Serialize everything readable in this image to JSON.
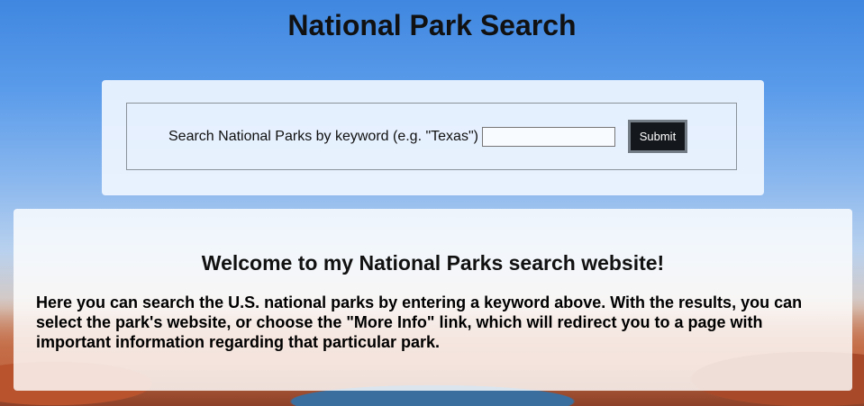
{
  "header": {
    "title": "National Park Search"
  },
  "search": {
    "label": "Search National Parks by keyword (e.g. \"Texas\")",
    "input_value": "",
    "submit_label": "Submit"
  },
  "welcome": {
    "heading": "Welcome to my National Parks search website!",
    "body": "Here you can search the U.S. national parks by entering a keyword above. With the results, you can select the park's website, or choose the \"More Info\" link, which will redirect you to a page with important information regarding that particular park."
  }
}
